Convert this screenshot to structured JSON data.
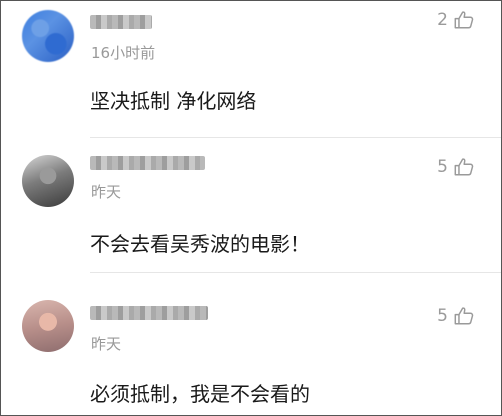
{
  "comments": [
    {
      "time": "16小时前",
      "text": "坚决抵制 净化网络",
      "likes": "2"
    },
    {
      "time": "昨天",
      "text": "不会去看吴秀波的电影！",
      "likes": "5"
    },
    {
      "time": "昨天",
      "text": "必须抵制，我是不会看的",
      "likes": "5"
    }
  ],
  "icons": {
    "like": "thumbs-up-icon",
    "avatar": "blurred-avatar"
  },
  "colors": {
    "meta_text": "#999999",
    "body_text": "#1a1a1a",
    "divider": "#e6e6e6"
  }
}
